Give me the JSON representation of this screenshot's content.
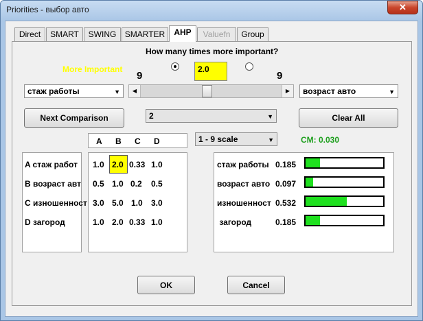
{
  "window": {
    "title": "Priorities - выбор авто",
    "close_glyph": "✕"
  },
  "tabs": [
    {
      "label": "Direct",
      "state": "normal"
    },
    {
      "label": "SMART",
      "state": "normal"
    },
    {
      "label": "SWING",
      "state": "normal"
    },
    {
      "label": "SMARTER",
      "state": "normal"
    },
    {
      "label": "AHP",
      "state": "active"
    },
    {
      "label": "Valuefn",
      "state": "disabled"
    },
    {
      "label": "Group",
      "state": "normal"
    }
  ],
  "question": "How many times more important?",
  "more_important_label": "More Important",
  "ratio_value": "2.0",
  "scale_left": "9",
  "scale_right": "9",
  "radio_left_selected": true,
  "radio_right_selected": false,
  "left_criterion": "стаж работы",
  "right_criterion": "возраст авто",
  "slider_position_fraction": 0.47,
  "next_comparison_label": "Next Comparison",
  "comparison_select": "2",
  "clear_all_label": "Clear All",
  "scale_select": "1 - 9 scale",
  "cm_label": "CM: 0.030",
  "matrix": {
    "col_headers": [
      "A",
      "B",
      "C",
      "D"
    ],
    "row_labels": [
      "A стаж работ",
      "B возраст авт",
      "C изношенност",
      "D  загород"
    ],
    "rows": [
      [
        "1.0",
        "2.0",
        "0.33",
        "1.0"
      ],
      [
        "0.5",
        "1.0",
        "0.2",
        "0.5"
      ],
      [
        "3.0",
        "5.0",
        "1.0",
        "3.0"
      ],
      [
        "1.0",
        "2.0",
        "0.33",
        "1.0"
      ]
    ],
    "highlight_cell": "A-B"
  },
  "weights": [
    {
      "label": "стаж работы",
      "value": "0.185",
      "fraction": 0.185
    },
    {
      "label": "возраст авто",
      "value": "0.097",
      "fraction": 0.097
    },
    {
      "label": "изношенност",
      "value": "0.532",
      "fraction": 0.532
    },
    {
      "label": " загород",
      "value": "0.185",
      "fraction": 0.185
    }
  ],
  "ok_label": "OK",
  "cancel_label": "Cancel",
  "colors": {
    "highlight": "#ffff00",
    "more_important": "#ffff00",
    "cm": "#1fa01f",
    "bar_fill": "#1fe01f"
  }
}
